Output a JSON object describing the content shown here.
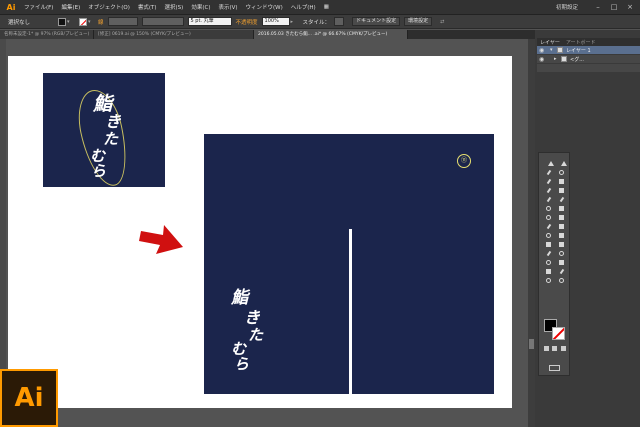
{
  "app": {
    "logo": "Ai",
    "workspace": "初期設定"
  },
  "menu": [
    "ファイル(F)",
    "編集(E)",
    "オブジェクト(O)",
    "書式(T)",
    "選択(S)",
    "効果(C)",
    "表示(V)",
    "ウィンドウ(W)",
    "ヘルプ(H)"
  ],
  "control_bar": {
    "selection_label": "選択なし",
    "stroke_label": "線",
    "stroke_weight": "5 pt. 丸筆",
    "opacity_label": "不透明度",
    "opacity_value": "100%",
    "style_label": "スタイル：",
    "document_settings": "ドキュメント設定",
    "preferences": "環境設定"
  },
  "tabs": [
    {
      "label": "名称未設定-1* @ 97% (RGB/プレビュー)",
      "active": false
    },
    {
      "label": "[修正] 0619.ai @ 150% (CMYK/プレビュー)",
      "active": false
    },
    {
      "label": "2016.05.03 きたむら鮨... .ai* @ 66.67% (CMYK/プレビュー)",
      "active": true
    }
  ],
  "artwork": {
    "logo_text_lines": [
      "鮨",
      "き",
      "た",
      "む",
      "ら"
    ],
    "badge": "⑪",
    "background_color": "#1b254c"
  },
  "layers_panel": {
    "tabs": [
      "レイヤー",
      "アートボード"
    ],
    "rows": [
      {
        "name": "レイヤー 1",
        "selected": true
      },
      {
        "name": "<グ...",
        "selected": false
      }
    ]
  },
  "badge_logo": "Ai",
  "colors": {
    "arrow": "#d01010",
    "accent": "#ff9a00"
  }
}
